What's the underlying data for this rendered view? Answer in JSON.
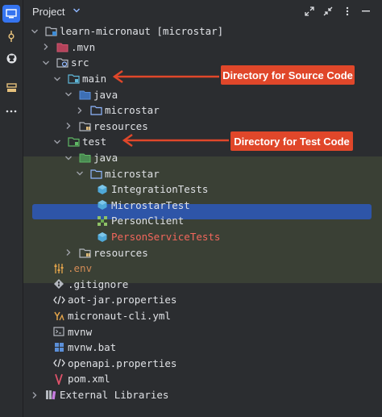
{
  "panel": {
    "title": "Project"
  },
  "tree": [
    {
      "label": "learn-micronaut [microstar]",
      "icon": "folder-module-icon"
    },
    {
      "label": ".mvn",
      "icon": "folder-excluded-icon"
    },
    {
      "label": "src",
      "icon": "folder-source-root-icon"
    },
    {
      "label": "main",
      "icon": "folder-source-icon"
    },
    {
      "label": "java",
      "icon": "folder-java-source-icon"
    },
    {
      "label": "microstar",
      "icon": "package-icon"
    },
    {
      "label": "resources",
      "icon": "folder-resources-icon"
    },
    {
      "label": "test",
      "icon": "folder-test-icon"
    },
    {
      "label": "java",
      "icon": "folder-java-test-icon"
    },
    {
      "label": "microstar",
      "icon": "package-icon"
    },
    {
      "label": "IntegrationTests",
      "icon": "test-class-icon"
    },
    {
      "label": "MicrostarTest",
      "icon": "test-class-icon"
    },
    {
      "label": "PersonClient",
      "icon": "interface-icon"
    },
    {
      "label": "PersonServiceTests",
      "icon": "test-class-icon"
    },
    {
      "label": "resources",
      "icon": "folder-resources-icon"
    },
    {
      "label": ".env",
      "icon": "env-file-icon"
    },
    {
      "label": ".gitignore",
      "icon": "gitignore-icon"
    },
    {
      "label": "aot-jar.properties",
      "icon": "properties-file-icon"
    },
    {
      "label": "micronaut-cli.yml",
      "icon": "yaml-file-icon"
    },
    {
      "label": "mvnw",
      "icon": "shell-script-icon"
    },
    {
      "label": "mvnw.bat",
      "icon": "batch-file-icon"
    },
    {
      "label": "openapi.properties",
      "icon": "properties-file-icon"
    },
    {
      "label": "pom.xml",
      "icon": "maven-icon"
    },
    {
      "label": "External Libraries",
      "icon": "libraries-icon"
    }
  ],
  "annotations": {
    "source": "Directory for Source Code",
    "test": "Directory for Test Code"
  },
  "colors": {
    "accent": "#3574f0",
    "selection": "#2e55a8",
    "callout": "#e0472a",
    "test_highlight": "#3a4035",
    "error_text": "#f2675c"
  }
}
